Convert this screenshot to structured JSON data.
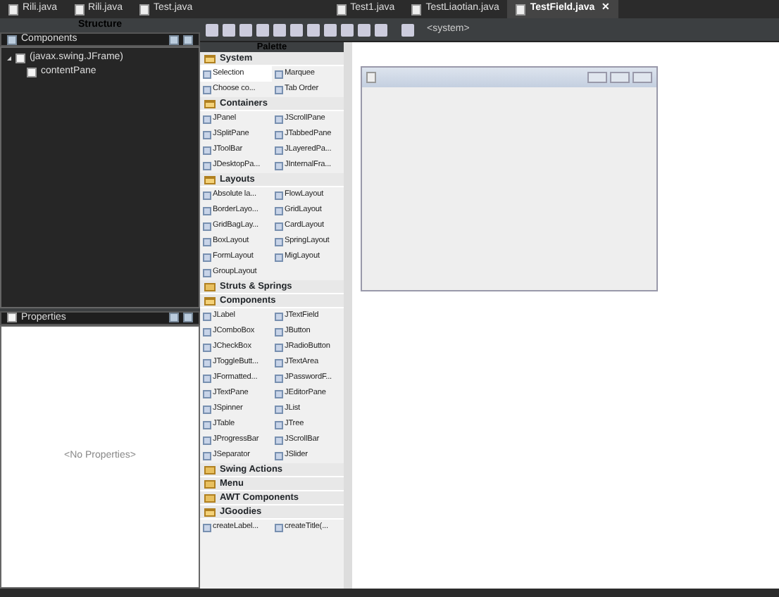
{
  "tabs": [
    {
      "label": "Rili.java",
      "selected": false
    },
    {
      "label": "Rili.java",
      "selected": false
    },
    {
      "label": "Test.java",
      "selected": false
    },
    {
      "label": "Test1.java",
      "selected": false
    },
    {
      "label": "TestLiaotian.java",
      "selected": false
    },
    {
      "label": "TestField.java",
      "selected": true,
      "close": "✕"
    }
  ],
  "structure": {
    "title": "Structure",
    "components_title": "Components",
    "tree": [
      {
        "label": "(javax.swing.JFrame)",
        "expanded": true,
        "children": [
          {
            "label": "contentPane"
          }
        ]
      }
    ]
  },
  "properties": {
    "title": "Properties",
    "empty_text": "<No Properties>"
  },
  "toolbar": {
    "dropdown": "<system>"
  },
  "palette": {
    "title": "Palette",
    "categories": [
      {
        "label": "System",
        "expanded": true,
        "items": [
          {
            "label": "Selection",
            "selected": true
          },
          {
            "label": "Marquee",
            "selected": false
          },
          {
            "label": "Choose co...",
            "selected": false
          },
          {
            "label": "Tab Order",
            "selected": false
          }
        ]
      },
      {
        "label": "Containers",
        "expanded": true,
        "items": [
          {
            "label": "JPanel",
            "selected": false
          },
          {
            "label": "JScrollPane",
            "selected": false
          },
          {
            "label": "JSplitPane",
            "selected": false
          },
          {
            "label": "JTabbedPane",
            "selected": false
          },
          {
            "label": "JToolBar",
            "selected": false
          },
          {
            "label": "JLayeredPa...",
            "selected": false
          },
          {
            "label": "JDesktopPa...",
            "selected": false
          },
          {
            "label": "JInternalFra...",
            "selected": false
          }
        ]
      },
      {
        "label": "Layouts",
        "expanded": true,
        "items": [
          {
            "label": "Absolute la...",
            "selected": false
          },
          {
            "label": "FlowLayout",
            "selected": false
          },
          {
            "label": "BorderLayo...",
            "selected": false
          },
          {
            "label": "GridLayout",
            "selected": false
          },
          {
            "label": "GridBagLay...",
            "selected": false
          },
          {
            "label": "CardLayout",
            "selected": false
          },
          {
            "label": "BoxLayout",
            "selected": false
          },
          {
            "label": "SpringLayout",
            "selected": false
          },
          {
            "label": "FormLayout",
            "selected": false
          },
          {
            "label": "MigLayout",
            "selected": false
          },
          {
            "label": "GroupLayout",
            "selected": false
          }
        ]
      },
      {
        "label": "Struts & Springs",
        "expanded": false
      },
      {
        "label": "Components",
        "expanded": true,
        "items": [
          {
            "label": "JLabel",
            "selected": false
          },
          {
            "label": "JTextField",
            "selected": false
          },
          {
            "label": "JComboBox",
            "selected": false
          },
          {
            "label": "JButton",
            "selected": false
          },
          {
            "label": "JCheckBox",
            "selected": false
          },
          {
            "label": "JRadioButton",
            "selected": false
          },
          {
            "label": "JToggleButt...",
            "selected": false
          },
          {
            "label": "JTextArea",
            "selected": false
          },
          {
            "label": "JFormatted...",
            "selected": false
          },
          {
            "label": "JPasswordF...",
            "selected": false
          },
          {
            "label": "JTextPane",
            "selected": false
          },
          {
            "label": "JEditorPane",
            "selected": false
          },
          {
            "label": "JSpinner",
            "selected": false
          },
          {
            "label": "JList",
            "selected": false
          },
          {
            "label": "JTable",
            "selected": false
          },
          {
            "label": "JTree",
            "selected": false
          },
          {
            "label": "JProgressBar",
            "selected": false
          },
          {
            "label": "JScrollBar",
            "selected": false
          },
          {
            "label": "JSeparator",
            "selected": false
          },
          {
            "label": "JSlider",
            "selected": false
          }
        ]
      },
      {
        "label": "Swing Actions",
        "expanded": false
      },
      {
        "label": "Menu",
        "expanded": false
      },
      {
        "label": "AWT Components",
        "expanded": false
      },
      {
        "label": "JGoodies",
        "expanded": true,
        "items": [
          {
            "label": "createLabel...",
            "selected": false
          },
          {
            "label": "createTitle(...",
            "selected": false
          }
        ]
      }
    ]
  }
}
